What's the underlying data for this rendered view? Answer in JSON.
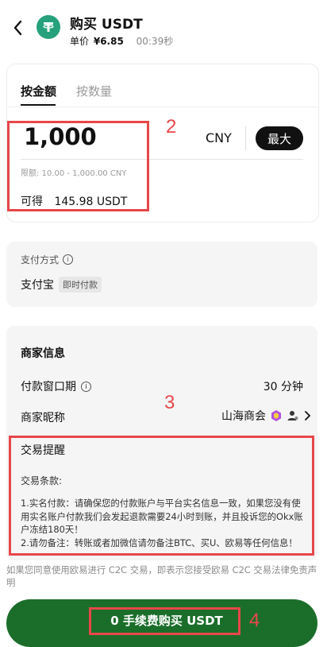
{
  "header": {
    "title": "购买 USDT",
    "price_label": "单价",
    "price_value": "¥6.85",
    "countdown": "00:39秒"
  },
  "tabs": {
    "by_amount": "按金额",
    "by_quantity": "按数量"
  },
  "amount": {
    "value": "1,000",
    "currency": "CNY",
    "max_label": "最大",
    "limit": "限额: 10.00 - 1,000.00 CNY",
    "receive_label": "可得",
    "receive_value": "145.98 USDT"
  },
  "payment": {
    "title": "支付方式",
    "method": "支付宝",
    "tag": "即时付款"
  },
  "merchant": {
    "section_title": "商家信息",
    "window_label": "付款窗口期",
    "window_value": "30 分钟",
    "nick_label": "商家昵称",
    "nick_value": "山海商会"
  },
  "trade_notice": {
    "title": "交易提醒",
    "terms_label": "交易条款:",
    "text": "1.实名付款：请确保您的付款账户与平台实名信息一致，如果您没有使用实名账户付款我们会发起退款需要24小时到账，并且投诉您的Okx账户冻结180天！\n2.请勿备注：转账或者加微信请勿备注BTC、买U、欧易等任何信息！"
  },
  "disclaimer": "如果您同意使用欧易进行 C2C 交易，即表示您接受欧易 C2C 交易法律免责声明",
  "buy_button": "0 手续费购买 USDT",
  "annotations": {
    "a2": "2",
    "a3": "3",
    "a4": "4"
  },
  "colors": {
    "brand_green": "#1b6e2a",
    "annotation_red": "#e8474a",
    "tether_green": "#26a17b"
  }
}
